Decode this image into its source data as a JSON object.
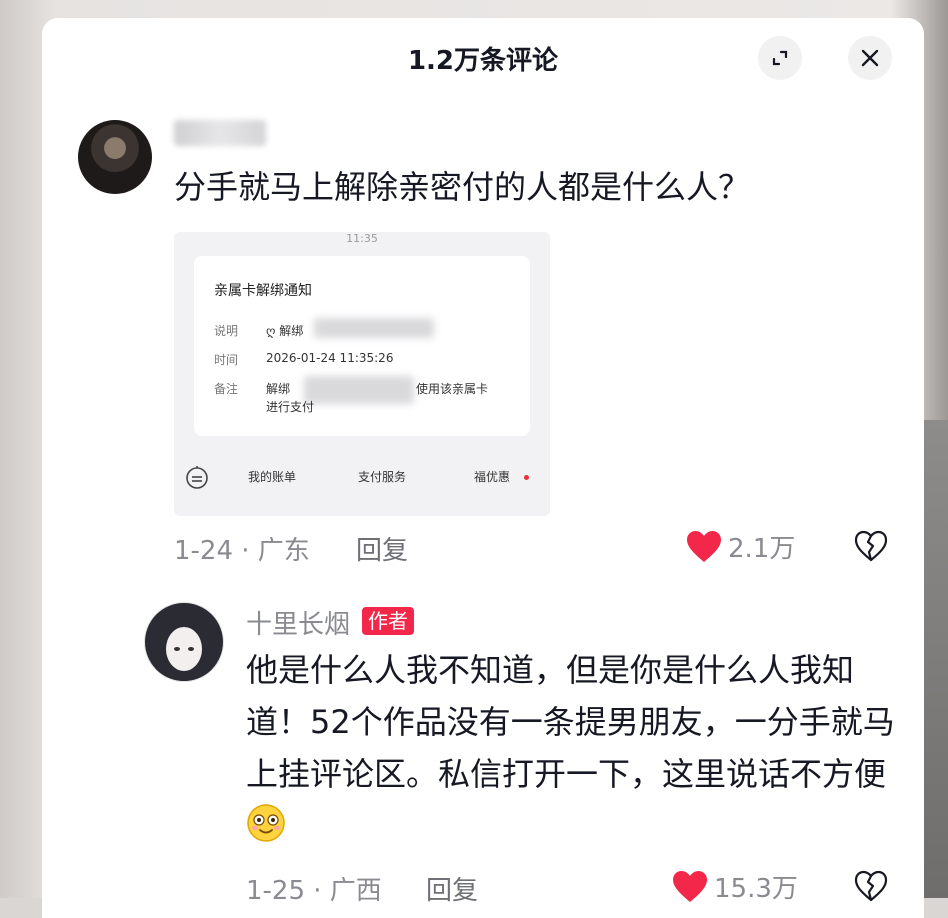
{
  "header": {
    "title": "1.2万条评论",
    "expand_icon": "expand-icon",
    "close_icon": "close-icon"
  },
  "comments": [
    {
      "avatar": "user-avatar",
      "text": "分手就马上解除亲密付的人都是什么人？",
      "attachment": {
        "status_time": "11:35",
        "card_title": "亲属卡解绑通知",
        "rows": [
          {
            "label": "说明",
            "value": "ღ 解绑"
          },
          {
            "label": "时间",
            "value": "2026-01-24 11:35:26"
          },
          {
            "label": "备注",
            "value": "解绑",
            "value_tail": "使用该亲属卡",
            "value_line2": "进行支付"
          }
        ],
        "bottom_tabs": [
          "我的账单",
          "支付服务",
          "福优惠"
        ]
      },
      "date_location": "1-24 · 广东",
      "reply_label": "回复",
      "likes": "2.1万",
      "liked": true
    },
    {
      "author_name": "十里长烟",
      "author_badge": "作者",
      "text": "他是什么人我不知道，但是你是什么人我知道！52个作品没有一条提男朋友，一分手就马上挂评论区。私信打开一下，这里说话不方便",
      "emoji": "smile-emoji",
      "date_location": "1-25 · 广西",
      "reply_label": "回复",
      "likes": "15.3万",
      "liked": true
    }
  ],
  "colors": {
    "like_red": "#f2274a",
    "text_primary": "#161823",
    "text_secondary": "#8a8b91"
  }
}
